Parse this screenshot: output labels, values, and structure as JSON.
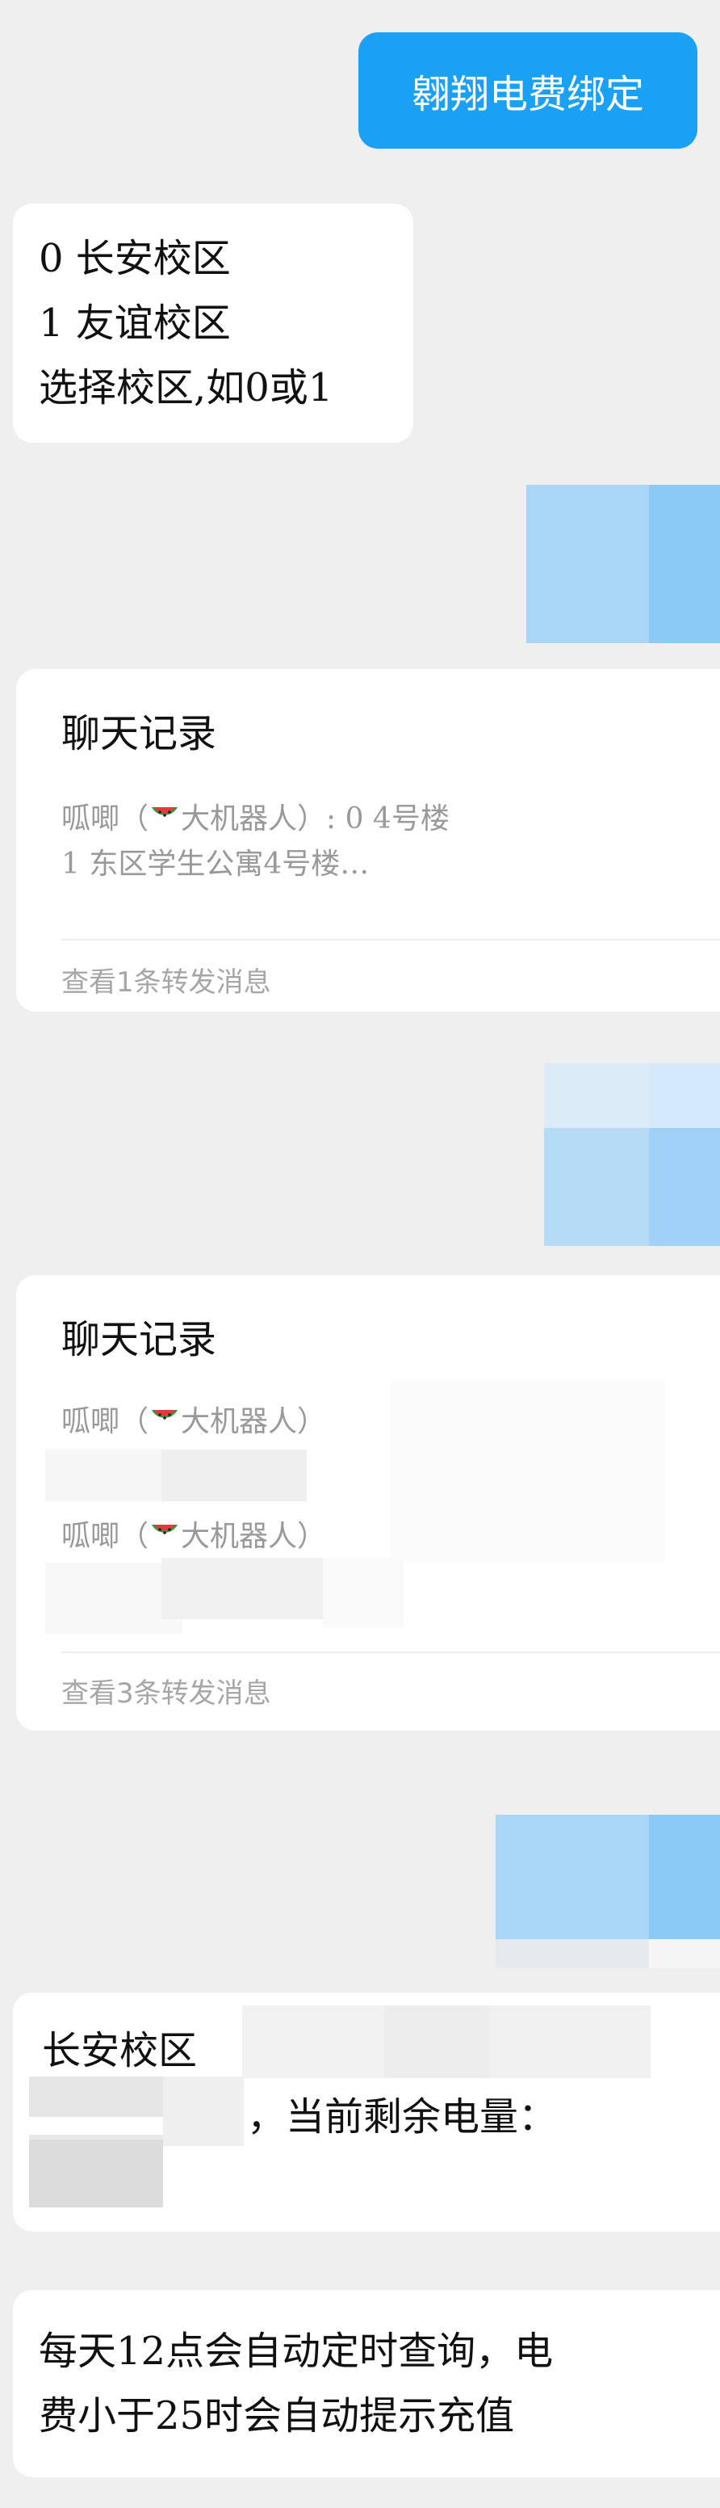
{
  "messages": {
    "bind_command": "翱翔电费绑定",
    "campus_menu": {
      "line1": "0  长安校区",
      "line2": "1  友谊校区",
      "line3": "选择校区,如0或1"
    },
    "forward1": {
      "title": "聊天记录",
      "line1_prefix": "呱唧（",
      "line1_name": "大机器人）: 0  4号楼",
      "line2": "1  东区学生公寓4号楼…",
      "footer": "查看1条转发消息"
    },
    "forward2": {
      "title": "聊天记录",
      "line1_prefix": "呱唧（",
      "line1_name": "大机器人）",
      "line2_prefix": "呱唧（",
      "line2_name": "大机器人）",
      "footer": "查看3条转发消息"
    },
    "result": {
      "line1": "长安校区",
      "line2": "，当前剩余电量："
    },
    "notice": {
      "line1": "每天12点会自动定时查询，电",
      "line2": "费小于25时会自动提示充值"
    }
  },
  "colors": {
    "sent_bubble": "#1aa0f4",
    "background": "#efefef",
    "card": "#ffffff",
    "muted_text": "#999999"
  }
}
